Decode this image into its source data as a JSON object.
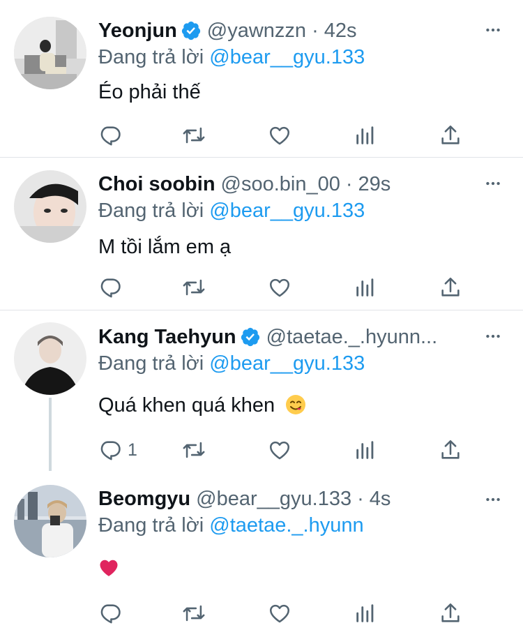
{
  "reply_prefix": "Đang trả lời",
  "tweets": [
    {
      "name": "Yeonjun",
      "verified": true,
      "handle": "@yawnzzn",
      "time": "42s",
      "reply_to": "@bear__gyu.133",
      "text": "Éo phải thế",
      "reply_count": ""
    },
    {
      "name": "Choi soobin",
      "verified": false,
      "handle": "@soo.bin_00",
      "time": "29s",
      "reply_to": "@bear__gyu.133",
      "text": "M tồi lắm em ạ",
      "reply_count": ""
    },
    {
      "name": "Kang Taehyun",
      "verified": true,
      "handle": "@taetae._.hyunn...",
      "time": "",
      "reply_to": "@bear__gyu.133",
      "text": "Quá khen quá khen",
      "text_emoji": "yum-face",
      "reply_count": "1"
    },
    {
      "name": "Beomgyu",
      "verified": false,
      "handle": "@bear__gyu.133",
      "time": "4s",
      "reply_to": "@taetae._.hyunn",
      "text": "",
      "text_emoji": "red-heart",
      "reply_count": ""
    }
  ],
  "icons": [
    "reply-icon",
    "retweet-icon",
    "like-icon",
    "views-icon",
    "share-icon",
    "more-icon",
    "verified-badge-icon"
  ],
  "colors": {
    "accent": "#1d9bf0",
    "secondary_text": "#536471",
    "heart": "#e0245e"
  }
}
